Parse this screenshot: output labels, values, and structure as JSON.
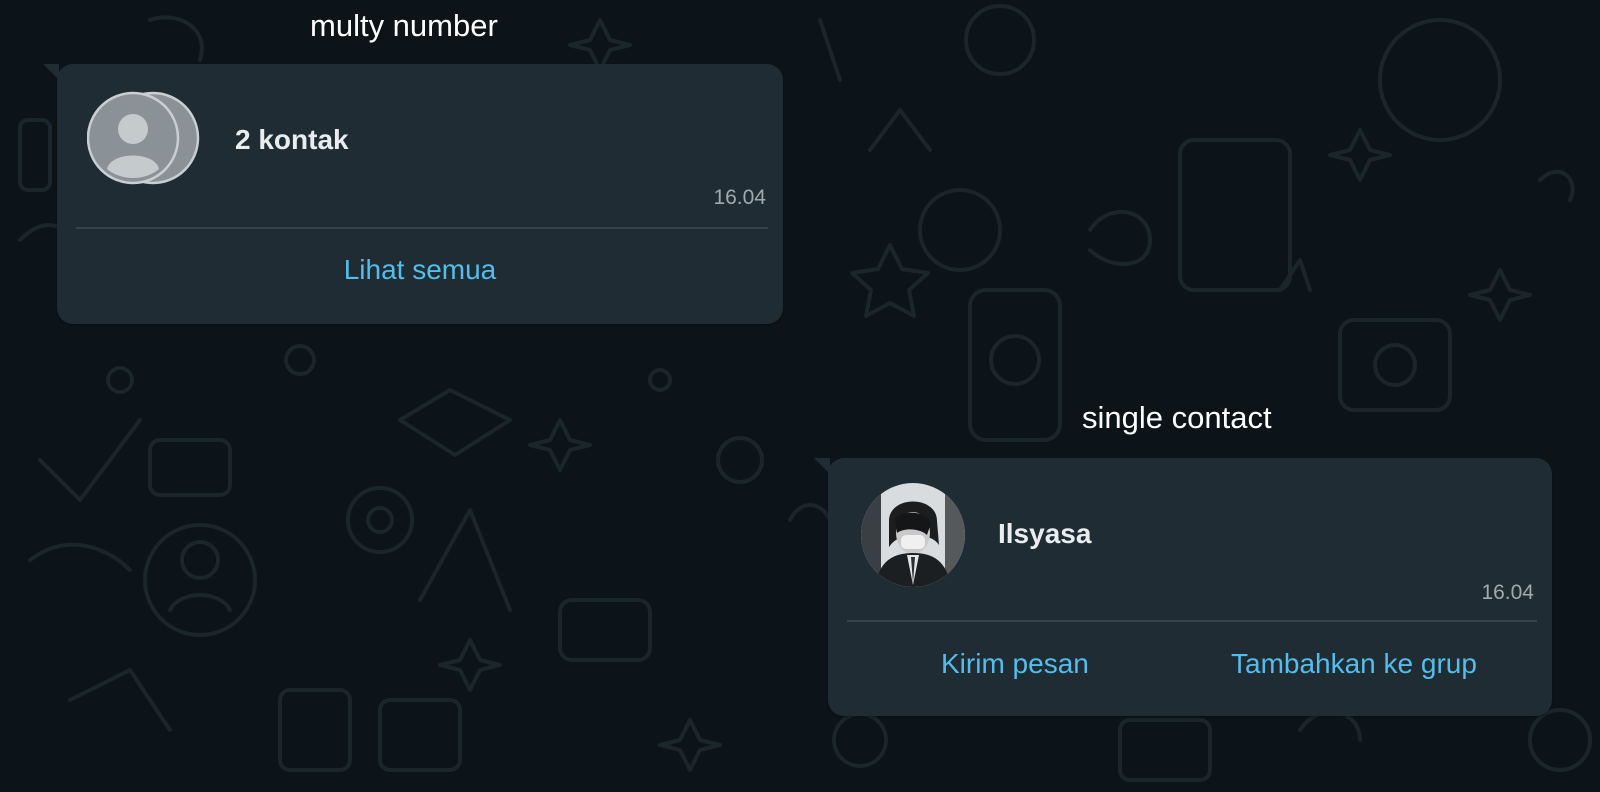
{
  "captions": {
    "multi": "multy number",
    "single": "single contact"
  },
  "multi_contact_bubble": {
    "title": "2 kontak",
    "time": "16.04",
    "action_label": "Lihat semua",
    "avatar_icon": "default-avatar-stack-icon"
  },
  "single_contact_bubble": {
    "name": "Ilsyasa",
    "time": "16.04",
    "actions": [
      {
        "label": "Kirim pesan"
      },
      {
        "label": "Tambahkan ke grup"
      }
    ],
    "avatar_icon": "contact-photo"
  },
  "colors": {
    "background": "#0c1419",
    "bubble": "#202c33",
    "link": "#53bdeb",
    "text": "#e9edef",
    "meta": "#9fa9ae"
  }
}
